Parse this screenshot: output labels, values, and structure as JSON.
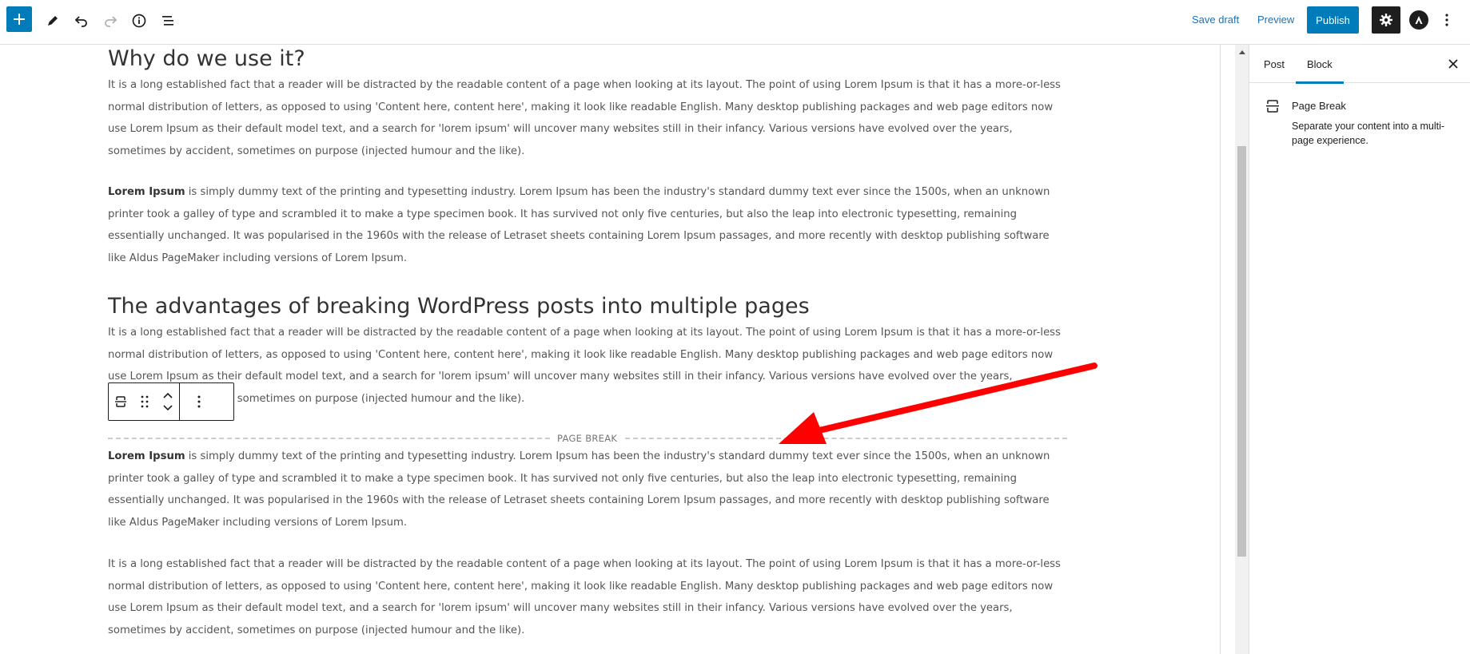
{
  "toolbar": {
    "save_draft": "Save draft",
    "preview": "Preview",
    "publish": "Publish",
    "accent_color": "#007cba"
  },
  "content": {
    "heading1": "Why do we use it?",
    "para1": "It is a long established fact that a reader will be distracted by the readable content of a page when looking at its layout. The point of using Lorem Ipsum is that it has a more-or-less normal distribution of letters, as opposed to using 'Content here, content here', making it look like readable English. Many desktop publishing packages and web page editors now use Lorem Ipsum as their default model text, and a search for 'lorem ipsum' will uncover many websites still in their infancy. Various versions have evolved over the years, sometimes by accident, sometimes on purpose (injected humour and the like).",
    "para2_bold": "Lorem Ipsum",
    "para2_rest": " is simply dummy text of the printing and typesetting industry. Lorem Ipsum has been the industry's standard dummy text ever since the 1500s, when an unknown printer took a galley of type and scrambled it to make a type specimen book. It has survived not only five centuries, but also the leap into electronic typesetting, remaining essentially unchanged. It was popularised in the 1960s with the release of Letraset sheets containing Lorem Ipsum passages, and more recently with desktop publishing software like Aldus PageMaker including versions of Lorem Ipsum.",
    "heading2": "The advantages of breaking WordPress posts into multiple pages",
    "para3": "It is a long established fact that a reader will be distracted by the readable content of a page when looking at its layout. The point of using Lorem Ipsum is that it has a more-or-less normal distribution of letters, as opposed to using 'Content here, content here', making it look like readable English. Many desktop publishing packages and web page editors now use Lorem Ipsum as their default model text, and a search for 'lorem ipsum' will uncover many websites still in their infancy. Various versions have evolved over the years, sometimes by accident, sometimes on purpose (injected humour and the like).",
    "page_break_label": "PAGE BREAK",
    "para4_bold": "Lorem Ipsum",
    "para4_rest": " is simply dummy text of the printing and typesetting industry. Lorem Ipsum has been the industry's standard dummy text ever since the 1500s, when an unknown printer took a galley of type and scrambled it to make a type specimen book. It has survived not only five centuries, but also the leap into electronic typesetting, remaining essentially unchanged. It was popularised in the 1960s with the release of Letraset sheets containing Lorem Ipsum passages, and more recently with desktop publishing software like Aldus PageMaker including versions of Lorem Ipsum.",
    "para5": "It is a long established fact that a reader will be distracted by the readable content of a page when looking at its layout. The point of using Lorem Ipsum is that it has a more-or-less normal distribution of letters, as opposed to using 'Content here, content here', making it look like readable English. Many desktop publishing packages and web page editors now use Lorem Ipsum as their default model text, and a search for 'lorem ipsum' will uncover many websites still in their infancy. Various versions have evolved over the years, sometimes by accident, sometimes on purpose (injected humour and the like)."
  },
  "sidebar": {
    "tabs": [
      {
        "label": "Post",
        "active": false
      },
      {
        "label": "Block",
        "active": true
      }
    ],
    "block_card": {
      "title": "Page Break",
      "description": "Separate your content into a multi-page experience."
    }
  },
  "annotation": {
    "arrow_color": "#ff0000"
  }
}
